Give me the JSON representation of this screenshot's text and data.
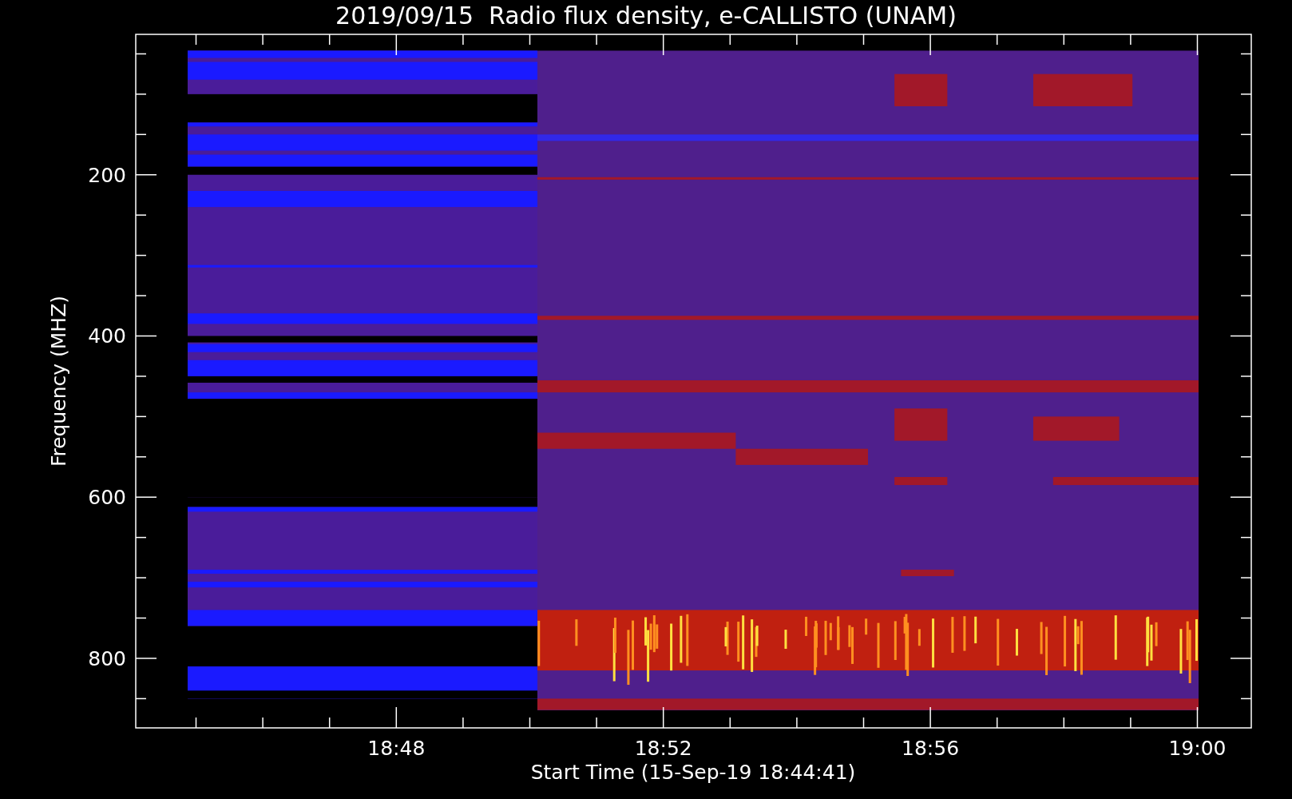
{
  "plot": {
    "title": "2019/09/15  Radio flux density, e-CALLISTO (UNAM)",
    "x_axis": {
      "label": "Start Time (15-Sep-19 18:44:41)",
      "ticks": [
        "18:48",
        "18:52",
        "18:56",
        "19:00"
      ]
    },
    "y_axis": {
      "label": "Frequency (MHZ)",
      "ticks": [
        "200",
        "400",
        "600",
        "800"
      ]
    }
  }
}
